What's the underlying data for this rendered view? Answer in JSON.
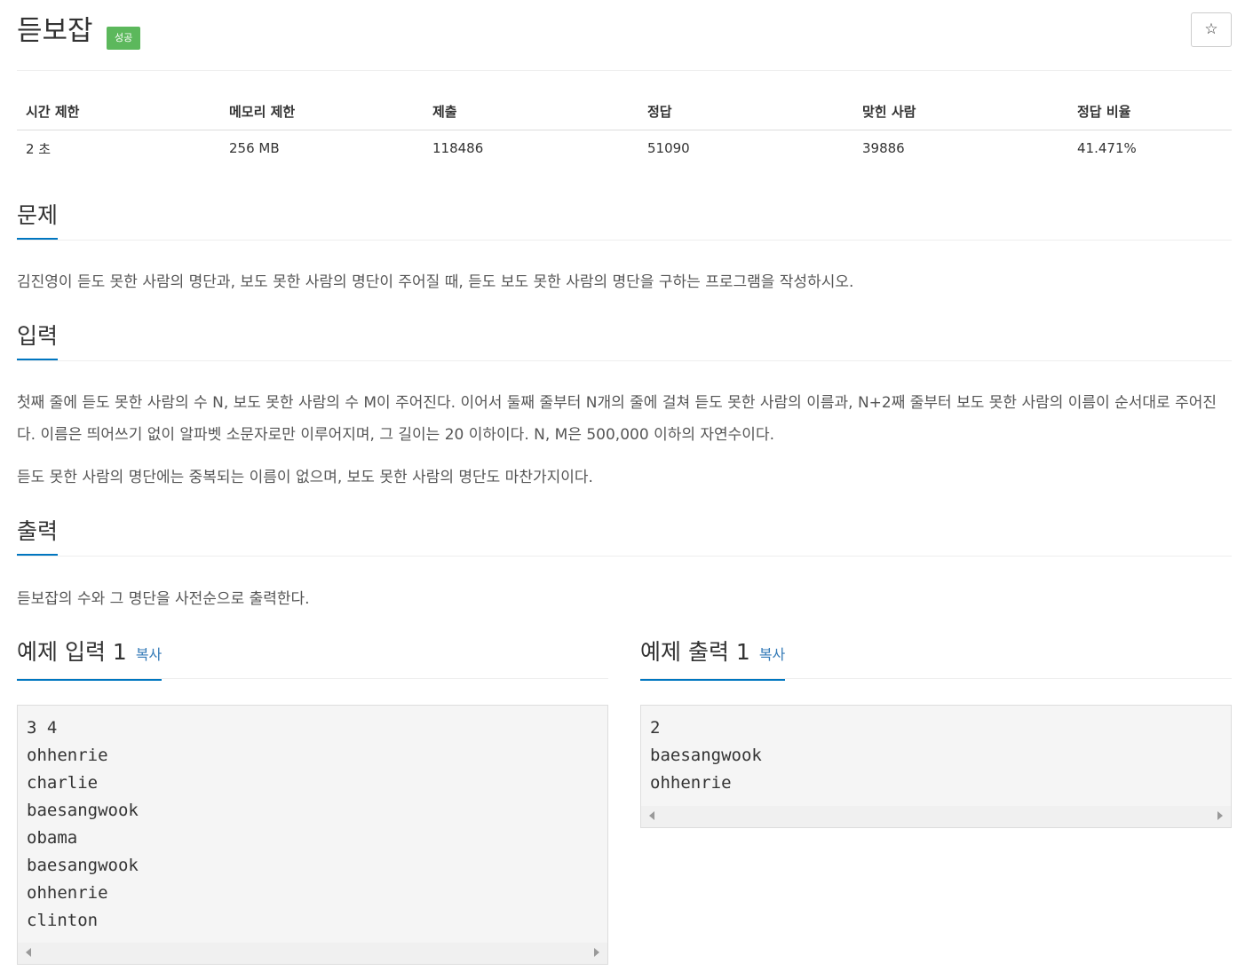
{
  "header": {
    "title": "듣보잡",
    "badge": "성공",
    "star_icon": "☆"
  },
  "info": {
    "headers": [
      "시간 제한",
      "메모리 제한",
      "제출",
      "정답",
      "맞힌 사람",
      "정답 비율"
    ],
    "values": [
      "2 초",
      "256 MB",
      "118486",
      "51090",
      "39886",
      "41.471%"
    ]
  },
  "problem": {
    "heading": "문제",
    "text": "김진영이 듣도 못한 사람의 명단과, 보도 못한 사람의 명단이 주어질 때, 듣도 보도 못한 사람의 명단을 구하는 프로그램을 작성하시오."
  },
  "input": {
    "heading": "입력",
    "para1": "첫째 줄에 듣도 못한 사람의 수 N, 보도 못한 사람의 수 M이 주어진다. 이어서 둘째 줄부터 N개의 줄에 걸쳐 듣도 못한 사람의 이름과, N+2째 줄부터 보도 못한 사람의 이름이 순서대로 주어진다. 이름은 띄어쓰기 없이 알파벳 소문자로만 이루어지며, 그 길이는 20 이하이다. N, M은 500,000 이하의 자연수이다.",
    "para2": "듣도 못한 사람의 명단에는 중복되는 이름이 없으며, 보도 못한 사람의 명단도 마찬가지이다."
  },
  "output": {
    "heading": "출력",
    "text": "듣보잡의 수와 그 명단을 사전순으로 출력한다."
  },
  "sample_input": {
    "heading": "예제 입력 1",
    "copy_label": "복사",
    "content": "3 4\nohhenrie\ncharlie\nbaesangwook\nobama\nbaesangwook\nohhenrie\nclinton"
  },
  "sample_output": {
    "heading": "예제 출력 1",
    "copy_label": "복사",
    "content": "2\nbaesangwook\nohhenrie"
  }
}
